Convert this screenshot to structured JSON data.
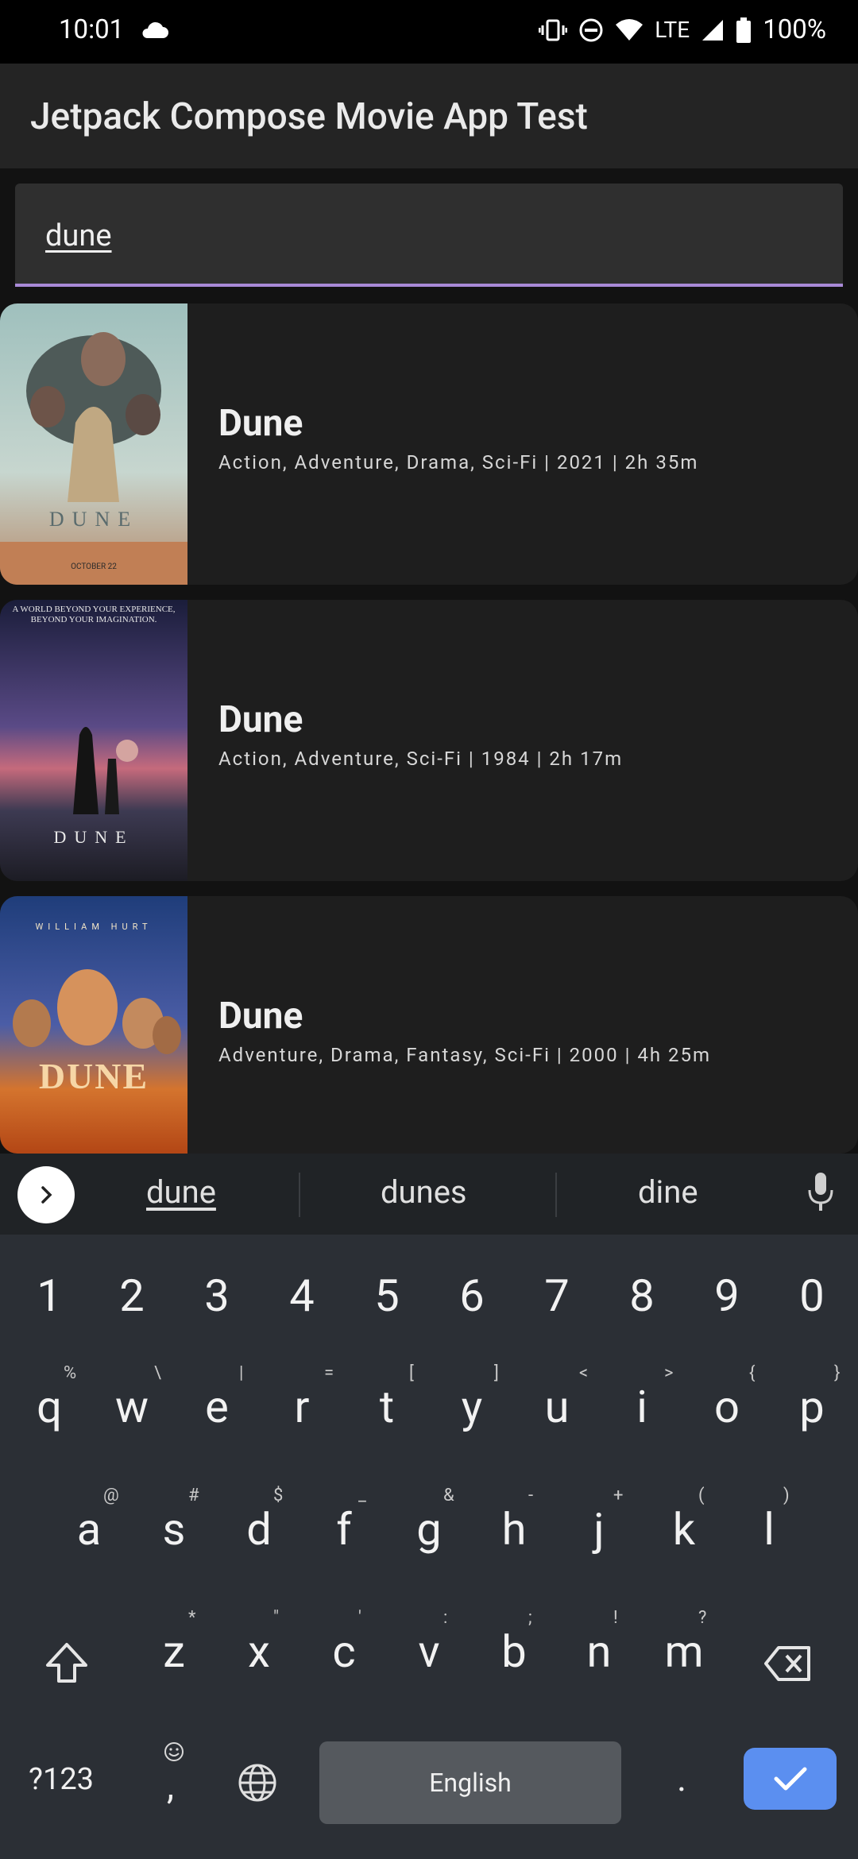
{
  "status_bar": {
    "time": "10:01",
    "network": "LTE",
    "battery": "100%"
  },
  "app_bar": {
    "title": "Jetpack Compose Movie App Test"
  },
  "search": {
    "value": "dune"
  },
  "movies": [
    {
      "title": "Dune",
      "meta": "Action, Adventure, Drama, Sci-Fi | 2021 | 2h 35m",
      "poster_text": "DUNE",
      "poster_subtext": "OCTOBER 22"
    },
    {
      "title": "Dune",
      "meta": "Action, Adventure, Sci-Fi | 1984 | 2h 17m",
      "poster_text": "DUNE",
      "poster_subtext": "A WORLD BEYOND YOUR EXPERIENCE, BEYOND YOUR IMAGINATION."
    },
    {
      "title": "Dune",
      "meta": "Adventure, Drama, Fantasy, Sci-Fi | 2000 | 4h 25m",
      "poster_text": "DUNE",
      "poster_subtext": "WILLIAM HURT"
    }
  ],
  "keyboard": {
    "suggestions": [
      "dune",
      "dunes",
      "dine"
    ],
    "numbers": [
      "1",
      "2",
      "3",
      "4",
      "5",
      "6",
      "7",
      "8",
      "9",
      "0"
    ],
    "row1": [
      "q",
      "w",
      "e",
      "r",
      "t",
      "y",
      "u",
      "i",
      "o",
      "p"
    ],
    "row1_hints": [
      "%",
      "\\",
      "|",
      "=",
      "[",
      "]",
      "<",
      ">",
      "{",
      "}"
    ],
    "row2": [
      "a",
      "s",
      "d",
      "f",
      "g",
      "h",
      "j",
      "k",
      "l"
    ],
    "row2_hints": [
      "@",
      "#",
      "$",
      "_",
      "&",
      "-",
      "+",
      "(",
      ")"
    ],
    "row3": [
      "z",
      "x",
      "c",
      "v",
      "b",
      "n",
      "m"
    ],
    "row3_hints": [
      "*",
      "\"",
      "'",
      ":",
      ";",
      "!",
      "?"
    ],
    "symbols_key": "?123",
    "comma_key": ",",
    "space_label": "English",
    "period_key": "."
  }
}
